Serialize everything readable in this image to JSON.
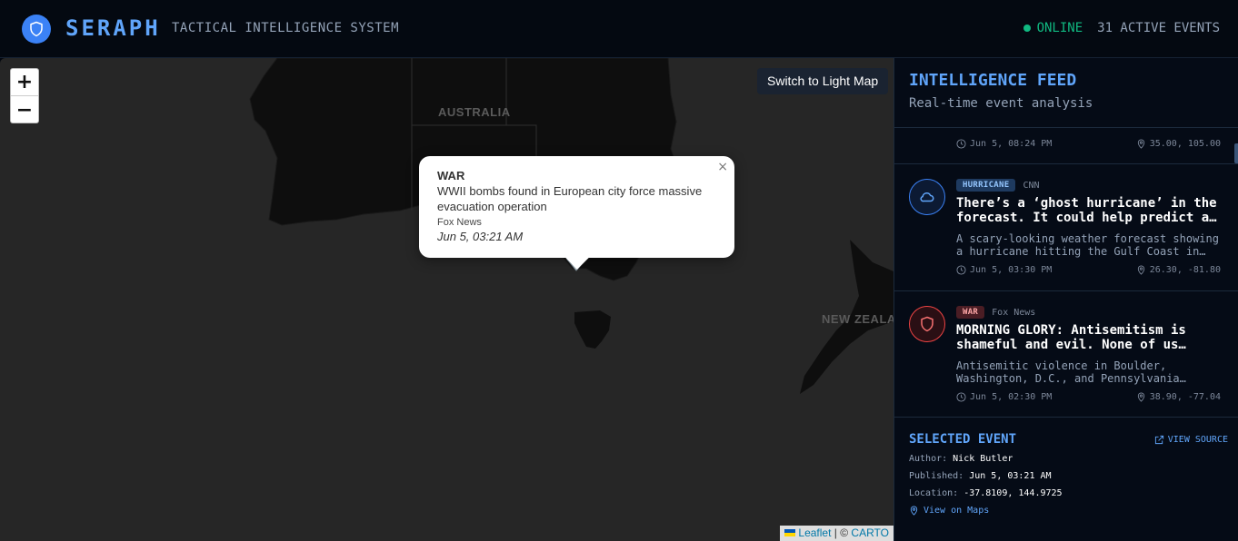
{
  "header": {
    "brand": "SERAPH",
    "subtitle": "TACTICAL INTELLIGENCE SYSTEM",
    "status": "ONLINE",
    "active_events": "31 ACTIVE EVENTS",
    "accent_color": "#60a5fa",
    "status_color": "#10b981",
    "logo_icon": "shield-icon"
  },
  "map": {
    "zoom_in": "+",
    "zoom_out": "−",
    "switch_label": "Switch to Light Map",
    "labels": {
      "australia": "AUSTRALIA",
      "new_zealand": "NEW ZEALA"
    },
    "attribution": {
      "leaflet": "Leaflet",
      "separator": "| ©",
      "carto": "CARTO"
    },
    "popup": {
      "type": "WAR",
      "title": "WWII bombs found in European city force massive evacuation operation",
      "source": "Fox News",
      "date": "Jun 5, 03:21 AM",
      "close": "×"
    }
  },
  "feed": {
    "title": "INTELLIGENCE FEED",
    "subtitle": "Real-time event analysis",
    "partial_item": {
      "time": "Jun 5, 08:24 PM",
      "coords": "35.00, 105.00"
    },
    "items": [
      {
        "category": "HURRICANE",
        "source": "CNN",
        "title_line1": "There’s a ‘ghost hurricane’ in the",
        "title_line2": "forecast. It could help predict a…",
        "desc_line1": "A scary-looking weather forecast showing",
        "desc_line2": "a hurricane hitting the Gulf Coast in…",
        "time": "Jun 5, 03:30 PM",
        "coords": "26.30, -81.80",
        "icon": "cloud-icon"
      },
      {
        "category": "WAR",
        "source": "Fox News",
        "title_line1": "MORNING GLORY: Antisemitism is",
        "title_line2": "shameful and evil. None of us…",
        "desc_line1": "Antisemitic violence in Boulder,",
        "desc_line2": "Washington, D.C., and Pennsylvania…",
        "time": "Jun 5, 02:30 PM",
        "coords": "38.90, -77.04",
        "icon": "shield-icon"
      }
    ]
  },
  "selected": {
    "title": "SELECTED EVENT",
    "view_source": "VIEW SOURCE",
    "author_label": "Author:",
    "author": "Nick Butler",
    "published_label": "Published:",
    "published": "Jun 5, 03:21 AM",
    "location_label": "Location:",
    "location": "-37.8109, 144.9725",
    "maps_link": "View on Maps"
  }
}
